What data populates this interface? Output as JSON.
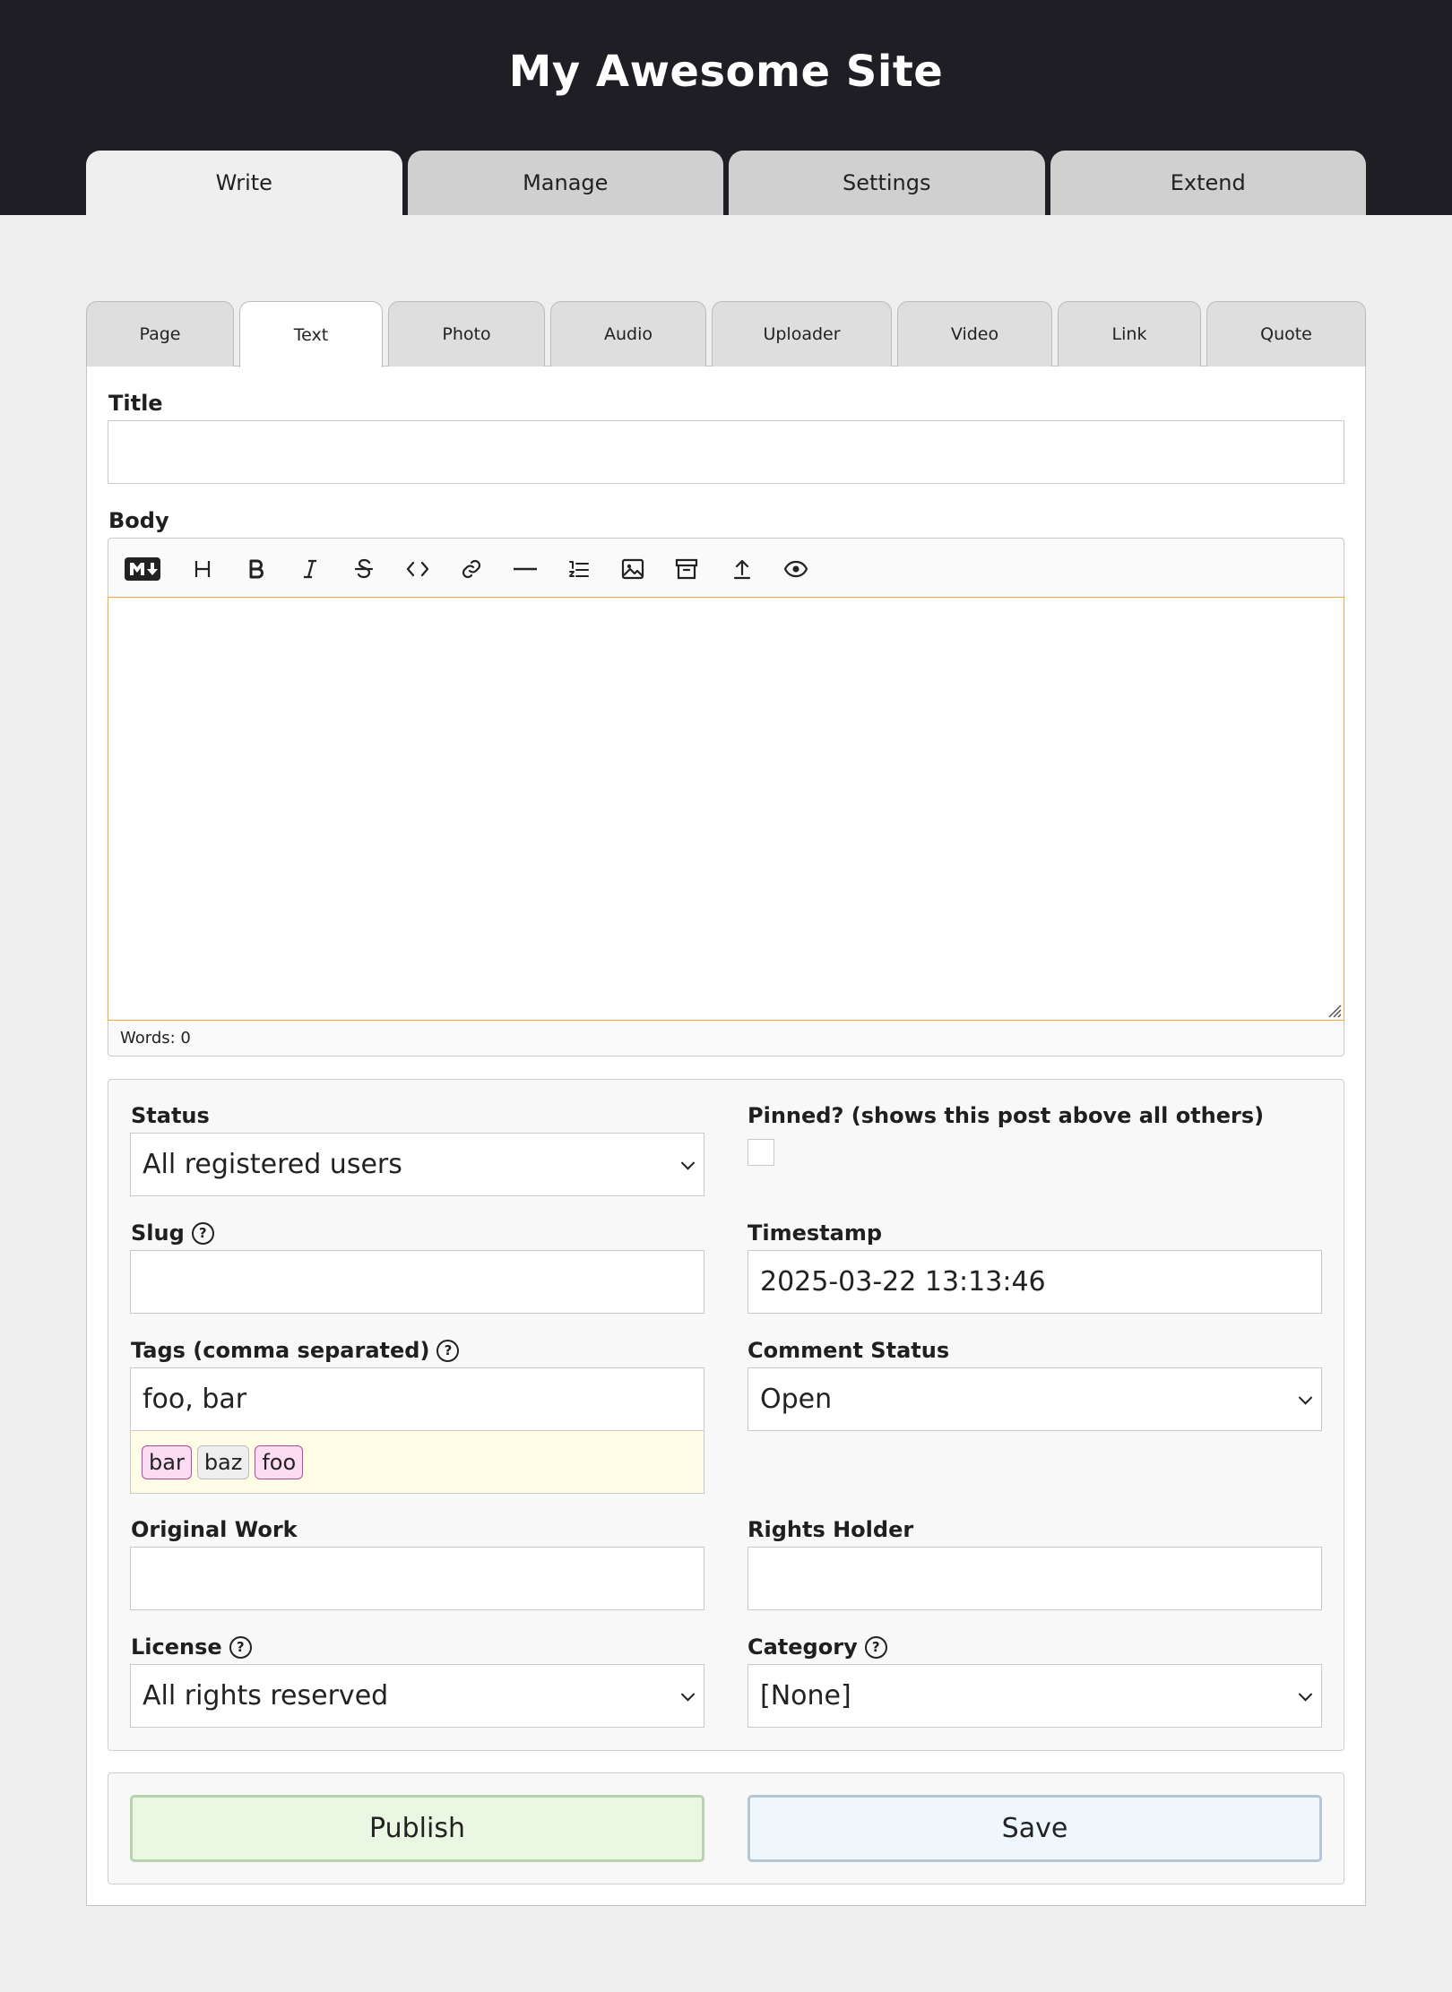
{
  "site": {
    "title": "My Awesome Site"
  },
  "main_tabs": [
    {
      "label": "Write",
      "active": true
    },
    {
      "label": "Manage"
    },
    {
      "label": "Settings"
    },
    {
      "label": "Extend"
    }
  ],
  "sub_tabs": [
    {
      "label": "Page"
    },
    {
      "label": "Text",
      "active": true
    },
    {
      "label": "Photo"
    },
    {
      "label": "Audio"
    },
    {
      "label": "Uploader"
    },
    {
      "label": "Video"
    },
    {
      "label": "Link"
    },
    {
      "label": "Quote"
    }
  ],
  "form": {
    "title_label": "Title",
    "title_value": "",
    "body_label": "Body",
    "body_value": "",
    "toolbar_icons": [
      "markdown-icon",
      "heading-icon",
      "bold-icon",
      "italic-icon",
      "strikethrough-icon",
      "code-icon",
      "link-icon",
      "horizontal-rule-icon",
      "ordered-list-icon",
      "image-icon",
      "archive-icon",
      "upload-icon",
      "preview-icon"
    ],
    "word_count": "Words: 0",
    "status_label": "Status",
    "status_value": "All registered users",
    "pinned_label": "Pinned? (shows this post above all others)",
    "pinned_checked": false,
    "slug_label": "Slug",
    "slug_value": "",
    "timestamp_label": "Timestamp",
    "timestamp_value": "2025-03-22 13:13:46",
    "tags_label": "Tags (comma separated)",
    "tags_value": "foo, bar",
    "tag_suggestions": [
      {
        "label": "bar",
        "selected": true
      },
      {
        "label": "baz",
        "selected": false
      },
      {
        "label": "foo",
        "selected": true
      }
    ],
    "comment_status_label": "Comment Status",
    "comment_status_value": "Open",
    "original_work_label": "Original Work",
    "original_work_value": "",
    "rights_holder_label": "Rights Holder",
    "rights_holder_value": "",
    "license_label": "License",
    "license_value": "All rights reserved",
    "category_label": "Category",
    "category_value": "[None]",
    "help_glyph": "?"
  },
  "actions": {
    "publish_label": "Publish",
    "save_label": "Save"
  },
  "colors": {
    "header_bg": "#1f1e24",
    "editor_focus": "#f0a93b",
    "publish_bg": "#eaf8e3",
    "save_bg": "#eff6fc",
    "tag_selected": "#fbdcf2"
  }
}
